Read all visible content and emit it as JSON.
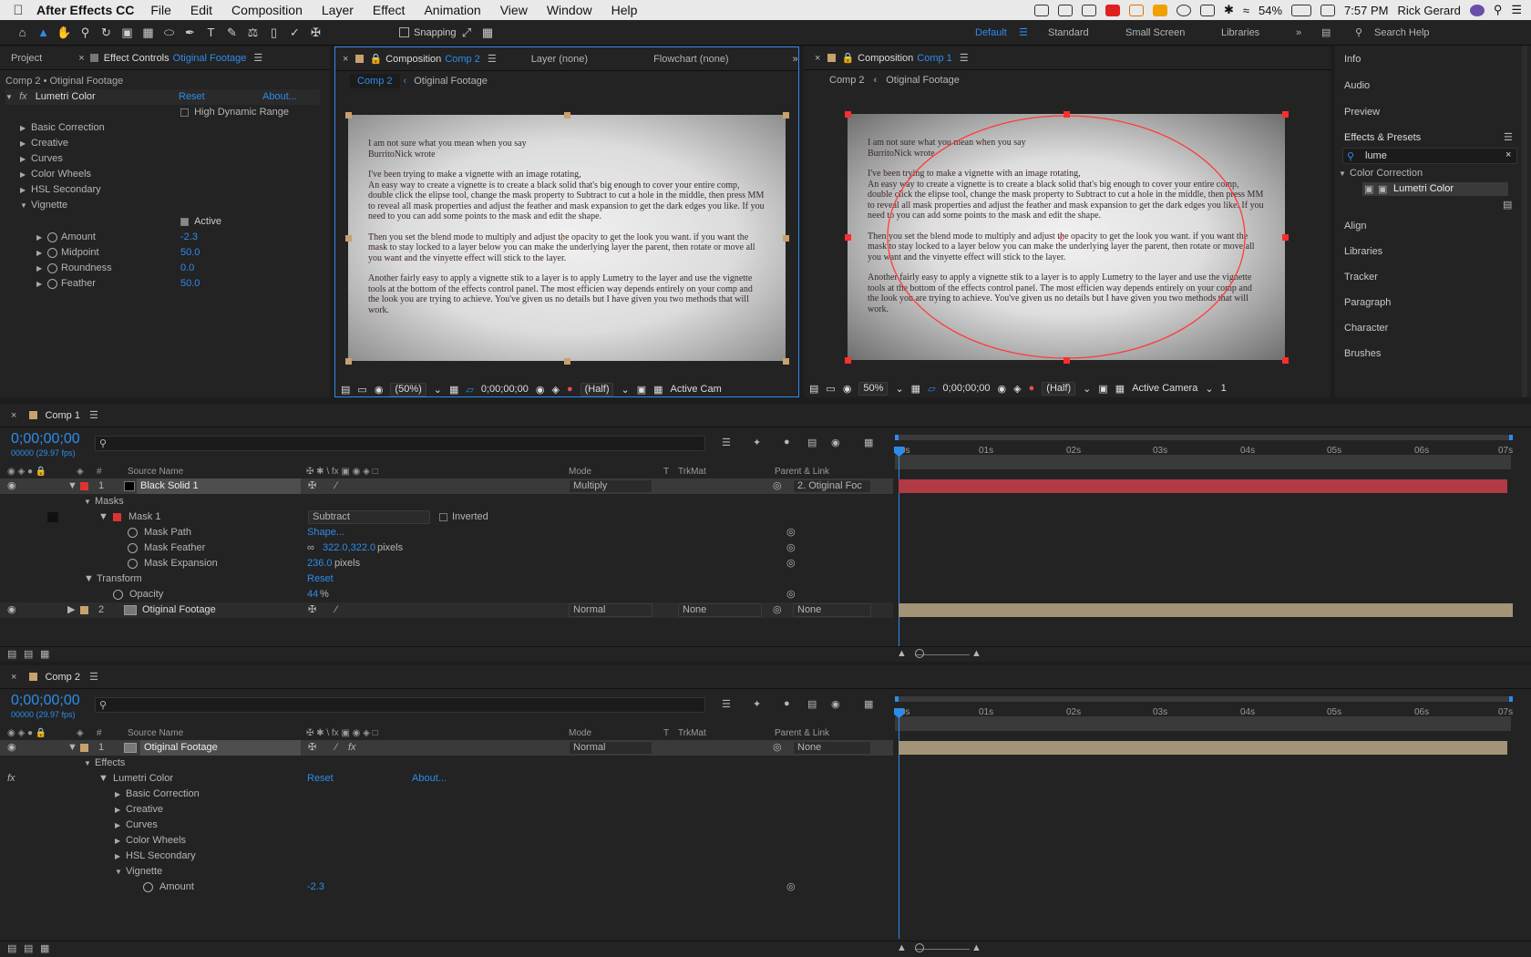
{
  "menubar": {
    "app": "After Effects CC",
    "items": [
      "File",
      "Edit",
      "Composition",
      "Layer",
      "Effect",
      "Animation",
      "View",
      "Window",
      "Help"
    ],
    "battery": "54%",
    "time": "7:57 PM",
    "user": "Rick Gerard"
  },
  "toolbar": {
    "snapping": "Snapping",
    "workspaces": [
      "Default",
      "Standard",
      "Small Screen",
      "Libraries"
    ],
    "search": "Search Help"
  },
  "left": {
    "tab_project": "Project",
    "tab_effect": "Effect Controls",
    "tab_effect_layer": "Otiginal Footage",
    "breadcrumb": "Comp 2 • Otiginal Footage",
    "effect": "Lumetri Color",
    "reset": "Reset",
    "about": "About...",
    "hdr": "High Dynamic Range",
    "groups": [
      "Basic Correction",
      "Creative",
      "Curves",
      "Color Wheels",
      "HSL Secondary",
      "Vignette"
    ],
    "active": "Active",
    "props": [
      {
        "n": "Amount",
        "v": "-2.3"
      },
      {
        "n": "Midpoint",
        "v": "50.0"
      },
      {
        "n": "Roundness",
        "v": "0.0"
      },
      {
        "n": "Feather",
        "v": "50.0"
      }
    ]
  },
  "viewer1": {
    "tab": "Composition",
    "comp": "Comp 2",
    "tab_layer": "Layer (none)",
    "tab_flow": "Flowchart (none)",
    "crumb1": "Comp 2",
    "crumb2": "Otiginal Footage",
    "zoom": "(50%)",
    "time": "0;00;00;00",
    "res": "(Half)",
    "cam": "Active Cam"
  },
  "viewer2": {
    "tab": "Composition",
    "comp": "Comp 1",
    "crumb1": "Comp 2",
    "crumb2": "Otiginal Footage",
    "zoom": "50%",
    "time": "0;00;00;00",
    "res": "(Half)",
    "cam": "Active Camera",
    "views": "1"
  },
  "footage": [
    "I am not sure what you mean when you say\nBurritoNick  wrote",
    "I've been trying to make a vignette with an image rotating,\nAn easy way to create a vignette is to create a black solid that's big enough to cover your entire comp, double click the elipse tool, change the mask property to Subtract to cut a hole in the middle, then press MM to reveal all mask properties and adjust the feather and mask expansion to get the dark edges you like. If you need to you can add some points to the mask and edit the shape.",
    "Then you set the blend mode to multiply and adjust the opacity to get the look you want. if you want the mask to stay locked to a layer below you can make the underlying layer the parent, then rotate or move all you want and the vinyette effect will stick to the layer.",
    "Another fairly easy to apply a vignette stik to a layer is to apply Lumetry to the layer and use the vignette tools at the bottom of the effects control panel. The most efficien way depends entirely on your comp and the look you are trying to achieve. You've given us no details but I have given you two methods that will work."
  ],
  "right": {
    "items": [
      "Info",
      "Audio",
      "Preview",
      "Effects & Presets"
    ],
    "search": "lume",
    "folder": "Color Correction",
    "effect": "Lumetri Color",
    "items2": [
      "Align",
      "Libraries",
      "Tracker",
      "Paragraph",
      "Character",
      "Brushes"
    ]
  },
  "tl1": {
    "tab": "Comp 1",
    "time": "0;00;00;00",
    "fps": "00000 (29.97 fps)",
    "cols": {
      "num": "#",
      "src": "Source Name",
      "mode": "Mode",
      "t": "T",
      "trk": "TrkMat",
      "parent": "Parent & Link"
    },
    "ticks": [
      "0s",
      "01s",
      "02s",
      "03s",
      "04s",
      "05s",
      "06s",
      "07s"
    ],
    "l1": {
      "num": "1",
      "name": "Black Solid 1",
      "mode": "Multiply",
      "parent": "2. Otiginal Foc"
    },
    "masks": "Masks",
    "mask1": "Mask 1",
    "maskmode": "Subtract",
    "inverted": "Inverted",
    "mp": "Mask Path",
    "mpv": "Shape...",
    "mf": "Mask Feather",
    "mfv": "322.0,322.0",
    "px": "pixels",
    "me": "Mask Expansion",
    "mev": "236.0",
    "transform": "Transform",
    "reset": "Reset",
    "op": "Opacity",
    "opv": "44",
    "l2": {
      "num": "2",
      "name": "Otiginal Footage",
      "mode": "Normal",
      "trk": "None",
      "parent": "None"
    }
  },
  "tl2": {
    "tab": "Comp 2",
    "time": "0;00;00;00",
    "fps": "00000 (29.97 fps)",
    "l1": {
      "num": "1",
      "name": "Otiginal Footage",
      "mode": "Normal",
      "parent": "None"
    },
    "effects": "Effects",
    "lumetri": "Lumetri Color",
    "reset": "Reset",
    "about": "About...",
    "groups": [
      "Basic Correction",
      "Creative",
      "Curves",
      "Color Wheels",
      "HSL Secondary",
      "Vignette"
    ],
    "amount": "Amount",
    "amountv": "-2.3"
  }
}
